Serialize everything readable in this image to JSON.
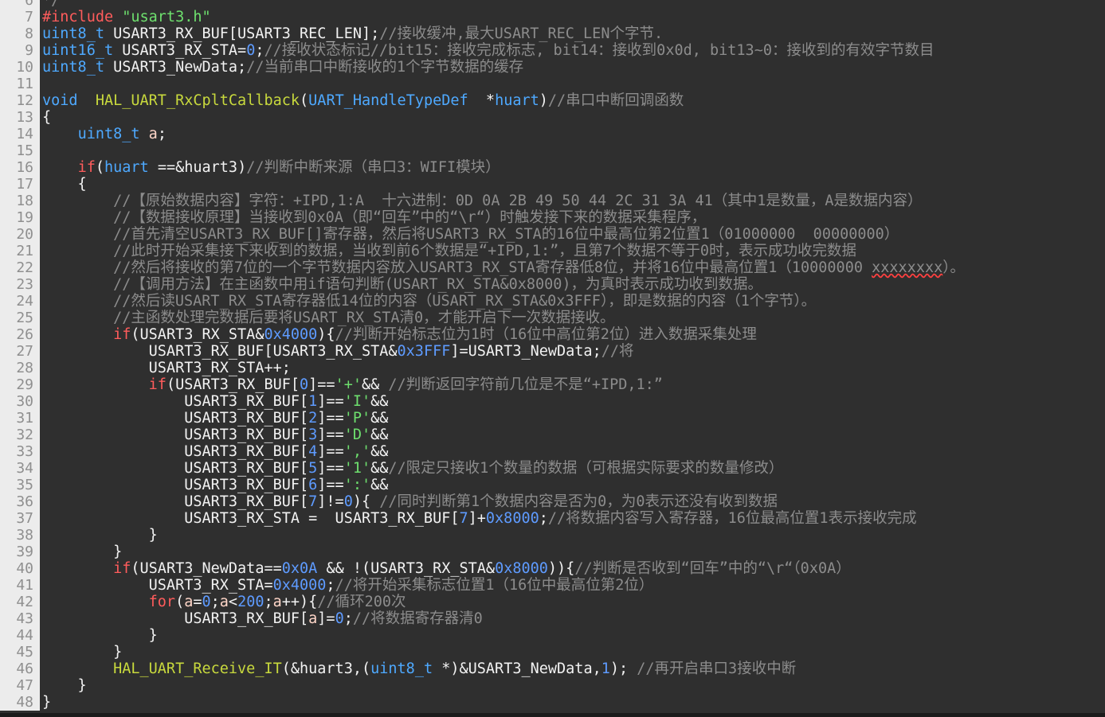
{
  "editor": {
    "lines": [
      {
        "n": "6",
        "segments": [
          {
            "t": "*/",
            "c": "cm"
          }
        ]
      },
      {
        "n": "7",
        "segments": [
          {
            "t": "#include ",
            "c": "pp"
          },
          {
            "t": "\"usart3.h\"",
            "c": "str"
          }
        ]
      },
      {
        "n": "8",
        "segments": [
          {
            "t": "uint8_t",
            "c": "ty"
          },
          {
            "t": " USART3_RX_BUF[USART3_REC_LEN];",
            "c": ""
          },
          {
            "t": "//接收缓冲,最大USART_REC_LEN个字节.",
            "c": "cm"
          }
        ]
      },
      {
        "n": "9",
        "segments": [
          {
            "t": "uint16_t",
            "c": "ty"
          },
          {
            "t": " USART3_RX_STA=",
            "c": ""
          },
          {
            "t": "0",
            "c": "num"
          },
          {
            "t": ";",
            "c": ""
          },
          {
            "t": "//接收状态标记//bit15：接收完成标志, bit14：接收到0x0d, bit13~0：接收到的有效字节数目",
            "c": "cm"
          }
        ]
      },
      {
        "n": "10",
        "segments": [
          {
            "t": "uint8_t",
            "c": "ty"
          },
          {
            "t": " USART3_NewData;",
            "c": ""
          },
          {
            "t": "//当前串口中断接收的1个字节数据的缓存",
            "c": "cm"
          }
        ]
      },
      {
        "n": "11",
        "segments": []
      },
      {
        "n": "12",
        "segments": [
          {
            "t": "void",
            "c": "kw"
          },
          {
            "t": "  ",
            "c": ""
          },
          {
            "t": "HAL_UART_RxCpltCallback",
            "c": "fn"
          },
          {
            "t": "(",
            "c": ""
          },
          {
            "t": "UART_HandleTypeDef",
            "c": "ty"
          },
          {
            "t": "  *",
            "c": ""
          },
          {
            "t": "huart",
            "c": "kw"
          },
          {
            "t": ")",
            "c": ""
          },
          {
            "t": "//串口中断回调函数",
            "c": "cm"
          }
        ]
      },
      {
        "n": "13",
        "segments": [
          {
            "t": "{",
            "c": ""
          }
        ]
      },
      {
        "n": "14",
        "segments": [
          {
            "t": "    ",
            "c": ""
          },
          {
            "t": "uint8_t",
            "c": "ty"
          },
          {
            "t": " ",
            "c": ""
          },
          {
            "t": "a",
            "c": "var"
          },
          {
            "t": ";",
            "c": ""
          }
        ]
      },
      {
        "n": "15",
        "segments": []
      },
      {
        "n": "16",
        "segments": [
          {
            "t": "    ",
            "c": ""
          },
          {
            "t": "if",
            "c": "pp"
          },
          {
            "t": "(",
            "c": ""
          },
          {
            "t": "huart",
            "c": "kw"
          },
          {
            "t": " ==&huart3)",
            "c": ""
          },
          {
            "t": "//判断中断来源（串口3：WIFI模块）",
            "c": "cm"
          }
        ]
      },
      {
        "n": "17",
        "segments": [
          {
            "t": "    {",
            "c": ""
          }
        ]
      },
      {
        "n": "18",
        "segments": [
          {
            "t": "        ",
            "c": ""
          },
          {
            "t": "//【原始数据内容】字符：+IPD,1:A  十六进制：0D 0A 2B 49 50 44 2C 31 3A 41（其中1是数量，A是数据内容）",
            "c": "cm"
          }
        ]
      },
      {
        "n": "19",
        "segments": [
          {
            "t": "        ",
            "c": ""
          },
          {
            "t": "//【数据接收原理】当接收到0x0A（即“回车”中的“\\r“）时触发接下来的数据采集程序，",
            "c": "cm"
          }
        ]
      },
      {
        "n": "20",
        "segments": [
          {
            "t": "        ",
            "c": ""
          },
          {
            "t": "//首先清空USART3_RX_BUF[]寄存器，然后将USART3_RX_STA的16位中最高位第2位置1（01000000  00000000）",
            "c": "cm"
          }
        ]
      },
      {
        "n": "21",
        "segments": [
          {
            "t": "        ",
            "c": ""
          },
          {
            "t": "//此时开始采集接下来收到的数据，当收到前6个数据是“+IPD,1:”，且第7个数据不等于0时，表示成功收完数据",
            "c": "cm"
          }
        ]
      },
      {
        "n": "22",
        "segments": [
          {
            "t": "        ",
            "c": ""
          },
          {
            "t": "//然后将接收的第7位的一个字节数据内容放入USART3_RX_STA寄存器低8位，并将16位中最高位置1（10000000 ",
            "c": "cm"
          },
          {
            "t": "xxxxxxxx",
            "c": "cm squig"
          },
          {
            "t": "）。",
            "c": "cm"
          }
        ]
      },
      {
        "n": "23",
        "segments": [
          {
            "t": "        ",
            "c": ""
          },
          {
            "t": "//【调用方法】在主函数中用if语句判断(USART_RX_STA&0x8000)，为真时表示成功收到数据。",
            "c": "cm"
          }
        ]
      },
      {
        "n": "24",
        "segments": [
          {
            "t": "        ",
            "c": ""
          },
          {
            "t": "//然后读USART_RX_STA寄存器低14位的内容（USART_RX_STA&0x3FFF），即是数据的内容（1个字节）。",
            "c": "cm"
          }
        ]
      },
      {
        "n": "25",
        "segments": [
          {
            "t": "        ",
            "c": ""
          },
          {
            "t": "//主函数处理完数据后要将USART_RX_STA清0，才能开启下一次数据接收。",
            "c": "cm"
          }
        ]
      },
      {
        "n": "26",
        "segments": [
          {
            "t": "        ",
            "c": ""
          },
          {
            "t": "if",
            "c": "pp"
          },
          {
            "t": "(USART3_RX_STA&",
            "c": ""
          },
          {
            "t": "0x4000",
            "c": "num"
          },
          {
            "t": "){",
            "c": ""
          },
          {
            "t": "//判断开始标志位为1时（16位中高位第2位）进入数据采集处理",
            "c": "cm"
          }
        ]
      },
      {
        "n": "27",
        "segments": [
          {
            "t": "            USART3_RX_BUF[USART3_RX_STA&",
            "c": ""
          },
          {
            "t": "0x3FFF",
            "c": "num"
          },
          {
            "t": "]=USART3_NewData;",
            "c": ""
          },
          {
            "t": "//将",
            "c": "cm"
          }
        ]
      },
      {
        "n": "28",
        "segments": [
          {
            "t": "            USART3_RX_STA++;",
            "c": ""
          }
        ]
      },
      {
        "n": "29",
        "segments": [
          {
            "t": "            ",
            "c": ""
          },
          {
            "t": "if",
            "c": "pp"
          },
          {
            "t": "(USART3_RX_BUF[",
            "c": ""
          },
          {
            "t": "0",
            "c": "num"
          },
          {
            "t": "]==",
            "c": ""
          },
          {
            "t": "'+'",
            "c": "str"
          },
          {
            "t": "&& ",
            "c": ""
          },
          {
            "t": "//判断返回字符前几位是不是“+IPD,1:”",
            "c": "cm"
          }
        ]
      },
      {
        "n": "30",
        "segments": [
          {
            "t": "                USART3_RX_BUF[",
            "c": ""
          },
          {
            "t": "1",
            "c": "num"
          },
          {
            "t": "]==",
            "c": ""
          },
          {
            "t": "'I'",
            "c": "str"
          },
          {
            "t": "&&",
            "c": ""
          }
        ]
      },
      {
        "n": "31",
        "segments": [
          {
            "t": "                USART3_RX_BUF[",
            "c": ""
          },
          {
            "t": "2",
            "c": "num"
          },
          {
            "t": "]==",
            "c": ""
          },
          {
            "t": "'P'",
            "c": "str"
          },
          {
            "t": "&&",
            "c": ""
          }
        ]
      },
      {
        "n": "32",
        "segments": [
          {
            "t": "                USART3_RX_BUF[",
            "c": ""
          },
          {
            "t": "3",
            "c": "num"
          },
          {
            "t": "]==",
            "c": ""
          },
          {
            "t": "'D'",
            "c": "str"
          },
          {
            "t": "&&",
            "c": ""
          }
        ]
      },
      {
        "n": "33",
        "segments": [
          {
            "t": "                USART3_RX_BUF[",
            "c": ""
          },
          {
            "t": "4",
            "c": "num"
          },
          {
            "t": "]==",
            "c": ""
          },
          {
            "t": "','",
            "c": "str"
          },
          {
            "t": "&&",
            "c": ""
          }
        ]
      },
      {
        "n": "34",
        "segments": [
          {
            "t": "                USART3_RX_BUF[",
            "c": ""
          },
          {
            "t": "5",
            "c": "num"
          },
          {
            "t": "]==",
            "c": ""
          },
          {
            "t": "'1'",
            "c": "str"
          },
          {
            "t": "&&",
            "c": ""
          },
          {
            "t": "//限定只接收1个数量的数据（可根据实际要求的数量修改）",
            "c": "cm"
          }
        ]
      },
      {
        "n": "35",
        "segments": [
          {
            "t": "                USART3_RX_BUF[",
            "c": ""
          },
          {
            "t": "6",
            "c": "num"
          },
          {
            "t": "]==",
            "c": ""
          },
          {
            "t": "':'",
            "c": "str"
          },
          {
            "t": "&&",
            "c": ""
          }
        ]
      },
      {
        "n": "36",
        "segments": [
          {
            "t": "                USART3_RX_BUF[",
            "c": ""
          },
          {
            "t": "7",
            "c": "num"
          },
          {
            "t": "]!=",
            "c": ""
          },
          {
            "t": "0",
            "c": "num"
          },
          {
            "t": "){ ",
            "c": ""
          },
          {
            "t": "//同时判断第1个数据内容是否为0，为0表示还没有收到数据",
            "c": "cm"
          }
        ]
      },
      {
        "n": "37",
        "segments": [
          {
            "t": "                USART3_RX_STA =  USART3_RX_BUF[",
            "c": ""
          },
          {
            "t": "7",
            "c": "num"
          },
          {
            "t": "]+",
            "c": ""
          },
          {
            "t": "0x8000",
            "c": "num"
          },
          {
            "t": ";",
            "c": ""
          },
          {
            "t": "//将数据内容写入寄存器，16位最高位置1表示接收完成",
            "c": "cm"
          }
        ]
      },
      {
        "n": "38",
        "segments": [
          {
            "t": "            }",
            "c": ""
          }
        ]
      },
      {
        "n": "39",
        "segments": [
          {
            "t": "        }",
            "c": ""
          }
        ]
      },
      {
        "n": "40",
        "segments": [
          {
            "t": "        ",
            "c": ""
          },
          {
            "t": "if",
            "c": "pp"
          },
          {
            "t": "(USART3_NewData==",
            "c": ""
          },
          {
            "t": "0x0A",
            "c": "num"
          },
          {
            "t": " && !(USART3_RX_STA&",
            "c": ""
          },
          {
            "t": "0x8000",
            "c": "num"
          },
          {
            "t": ")){",
            "c": ""
          },
          {
            "t": "//判断是否收到“回车”中的“\\r“（0x0A）",
            "c": "cm"
          }
        ]
      },
      {
        "n": "41",
        "segments": [
          {
            "t": "            USART3_RX_STA=",
            "c": ""
          },
          {
            "t": "0x4000",
            "c": "num"
          },
          {
            "t": ";",
            "c": ""
          },
          {
            "t": "//将开始采集标志位置1（16位中最高位第2位）",
            "c": "cm"
          }
        ]
      },
      {
        "n": "42",
        "segments": [
          {
            "t": "            ",
            "c": ""
          },
          {
            "t": "for",
            "c": "pp"
          },
          {
            "t": "(",
            "c": ""
          },
          {
            "t": "a",
            "c": "var"
          },
          {
            "t": "=",
            "c": ""
          },
          {
            "t": "0",
            "c": "num"
          },
          {
            "t": ";",
            "c": ""
          },
          {
            "t": "a",
            "c": "var"
          },
          {
            "t": "<",
            "c": ""
          },
          {
            "t": "200",
            "c": "num"
          },
          {
            "t": ";",
            "c": ""
          },
          {
            "t": "a",
            "c": "var"
          },
          {
            "t": "++){",
            "c": ""
          },
          {
            "t": "//循环200次",
            "c": "cm"
          }
        ]
      },
      {
        "n": "43",
        "segments": [
          {
            "t": "                USART3_RX_BUF[",
            "c": ""
          },
          {
            "t": "a",
            "c": "var"
          },
          {
            "t": "]=",
            "c": ""
          },
          {
            "t": "0",
            "c": "num"
          },
          {
            "t": ";",
            "c": ""
          },
          {
            "t": "//将数据寄存器清0",
            "c": "cm"
          }
        ]
      },
      {
        "n": "44",
        "segments": [
          {
            "t": "            }",
            "c": ""
          }
        ]
      },
      {
        "n": "45",
        "segments": [
          {
            "t": "        }",
            "c": ""
          }
        ]
      },
      {
        "n": "46",
        "segments": [
          {
            "t": "        ",
            "c": ""
          },
          {
            "t": "HAL_UART_Receive_IT",
            "c": "fn"
          },
          {
            "t": "(&huart3,(",
            "c": ""
          },
          {
            "t": "uint8_t",
            "c": "ty"
          },
          {
            "t": " *)&USART3_NewData,",
            "c": ""
          },
          {
            "t": "1",
            "c": "num"
          },
          {
            "t": "); ",
            "c": ""
          },
          {
            "t": "//再开启串口3接收中断",
            "c": "cm"
          }
        ]
      },
      {
        "n": "47",
        "segments": [
          {
            "t": "    }",
            "c": ""
          }
        ]
      },
      {
        "n": "48",
        "segments": [
          {
            "t": "}",
            "c": ""
          }
        ]
      }
    ]
  },
  "colors": {
    "background": "#2f2f2f",
    "gutter": "#ececec",
    "fold_marker": "#6e7e9f"
  }
}
